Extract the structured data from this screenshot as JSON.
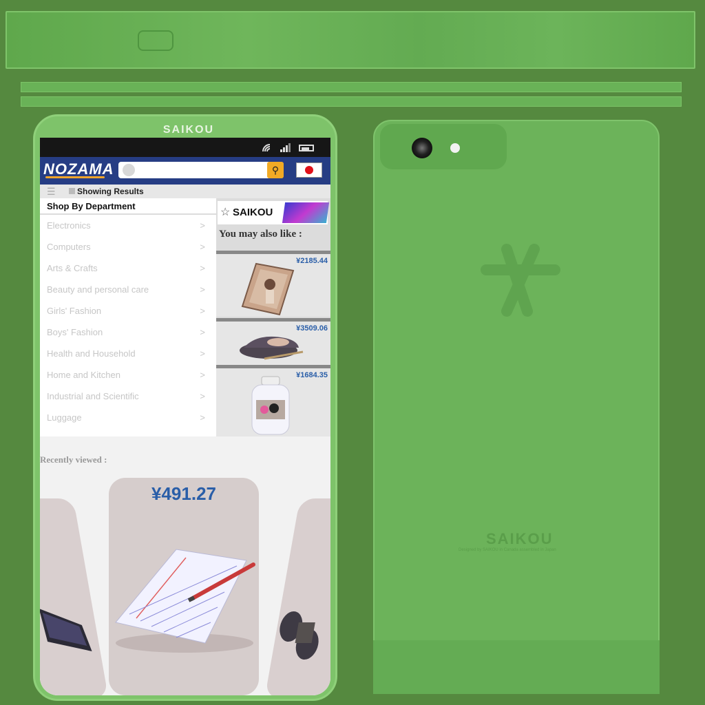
{
  "front": {
    "brand": "SAIKOU"
  },
  "status": {
    "wifi_icon": "wifi-icon",
    "signal_icon": "signal-icon",
    "battery_icon": "battery-icon",
    "battery_level": 0.75
  },
  "header": {
    "logo": "NOZAMA",
    "search_placeholder": "",
    "search_icon": "search-icon",
    "flag_icon": "japan-flag-icon"
  },
  "results": {
    "text": "Showing Results"
  },
  "department": {
    "title": "Shop By Department",
    "chevron": ">",
    "items": [
      "Electronics",
      "Computers",
      "Arts & Crafts",
      "Beauty and personal care",
      "Girls' Fashion",
      "Boys' Fashion",
      "Health and Household",
      "Home and Kitchen",
      "Industrial and Scientific",
      "Luggage"
    ]
  },
  "ad": {
    "brand": "SAIKOU"
  },
  "suggestions": {
    "title": "You may also like :",
    "products": [
      {
        "price": "¥2185.44",
        "image": "book-cover"
      },
      {
        "price": "¥3509.06",
        "image": "shoe"
      },
      {
        "price": "¥1684.35",
        "image": "bottle"
      }
    ]
  },
  "recent": {
    "title": "Recently viewed :",
    "main_price": "¥491.27",
    "main_image": "notepad-and-pencil"
  },
  "back": {
    "brand": "SAIKOU",
    "fine_print": "Designed by SAIKOU in Canada assembled in Japan"
  },
  "colors": {
    "accent_blue": "#263d84",
    "price_blue": "#2a5ea8",
    "search_orange": "#f2aa25",
    "phone_green": "#6cb35a"
  }
}
